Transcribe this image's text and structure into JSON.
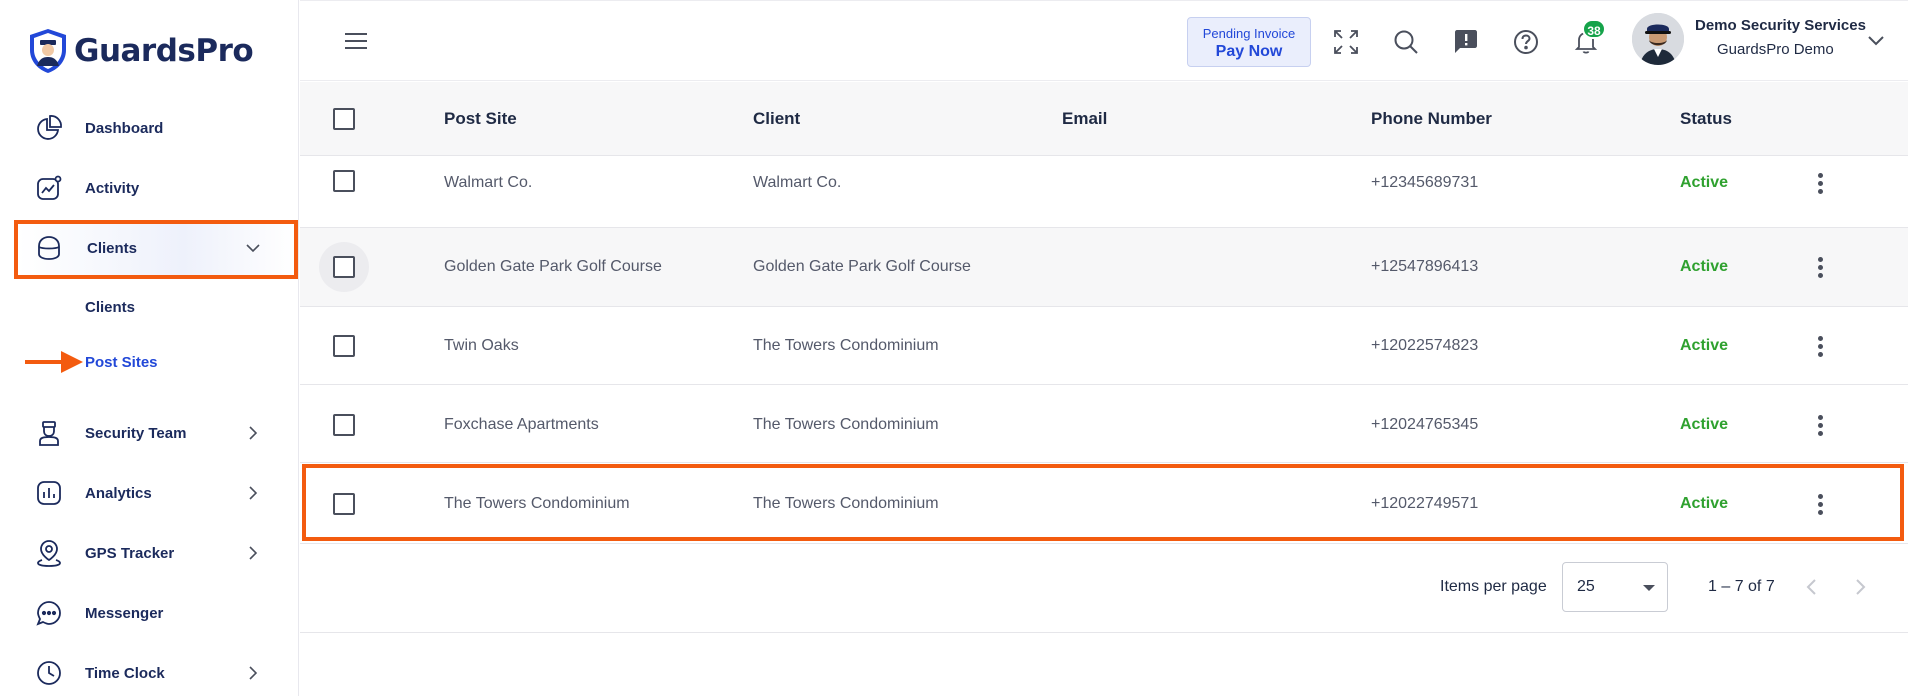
{
  "brand": {
    "name": "GuardsPro"
  },
  "sidebar": {
    "items": [
      {
        "label": "Dashboard",
        "icon": "dashboard-icon"
      },
      {
        "label": "Activity",
        "icon": "activity-icon"
      },
      {
        "label": "Clients",
        "icon": "clients-icon",
        "expanded": true
      },
      {
        "label": "Security Team",
        "icon": "security-team-icon"
      },
      {
        "label": "Analytics",
        "icon": "analytics-icon"
      },
      {
        "label": "GPS Tracker",
        "icon": "gps-tracker-icon"
      },
      {
        "label": "Messenger",
        "icon": "messenger-icon"
      },
      {
        "label": "Time Clock",
        "icon": "time-clock-icon"
      }
    ],
    "clients_sub": [
      {
        "label": "Clients",
        "active": false
      },
      {
        "label": "Post Sites",
        "active": true
      }
    ]
  },
  "header": {
    "invoice_line1": "Pending Invoice",
    "invoice_line2": "Pay Now",
    "notification_count": "38",
    "user_name": "Demo Security Services",
    "user_org": "GuardsPro Demo"
  },
  "table": {
    "columns": [
      "Post Site",
      "Client",
      "Email",
      "Phone Number",
      "Status"
    ],
    "rows": [
      {
        "post_site": "Walmart Co.",
        "client": "Walmart Co.",
        "email": "",
        "phone": "+12345689731",
        "status": "Active"
      },
      {
        "post_site": "Golden Gate Park Golf Course",
        "client": "Golden Gate Park Golf Course",
        "email": "",
        "phone": "+12547896413",
        "status": "Active"
      },
      {
        "post_site": "Twin Oaks",
        "client": "The Towers Condominium",
        "email": "",
        "phone": "+12022574823",
        "status": "Active"
      },
      {
        "post_site": "Foxchase Apartments",
        "client": "The Towers Condominium",
        "email": "",
        "phone": "+12024765345",
        "status": "Active"
      },
      {
        "post_site": "The Towers Condominium",
        "client": "The Towers Condominium",
        "email": "",
        "phone": "+12022749571",
        "status": "Active"
      }
    ]
  },
  "pager": {
    "items_per_page_label": "Items per page",
    "items_per_page": "25",
    "range": "1 – 7 of 7"
  },
  "colors": {
    "accent": "#f35b0f",
    "brand": "#1b2a5c",
    "link_active": "#2248d8",
    "status_active": "#2fa12f"
  }
}
